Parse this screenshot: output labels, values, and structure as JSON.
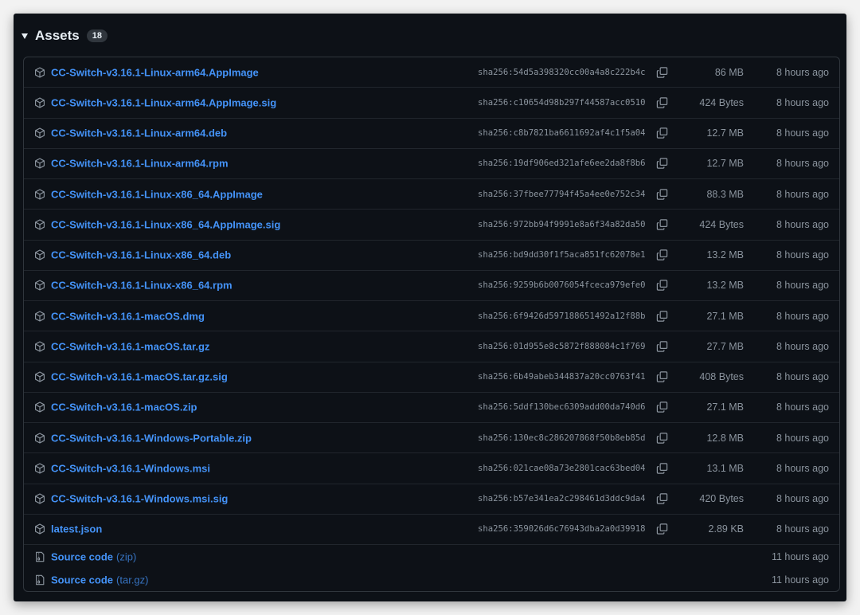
{
  "header": {
    "title": "Assets",
    "count": "18"
  },
  "assets": [
    {
      "name": "CC-Switch-v3.16.1-Linux-arm64.AppImage",
      "sha": "sha256:54d5a398320cc00a4a8c222b4c",
      "size": "86 MB",
      "time": "8 hours ago"
    },
    {
      "name": "CC-Switch-v3.16.1-Linux-arm64.AppImage.sig",
      "sha": "sha256:c10654d98b297f44587acc0510",
      "size": "424 Bytes",
      "time": "8 hours ago"
    },
    {
      "name": "CC-Switch-v3.16.1-Linux-arm64.deb",
      "sha": "sha256:c8b7821ba6611692af4c1f5a04",
      "size": "12.7 MB",
      "time": "8 hours ago"
    },
    {
      "name": "CC-Switch-v3.16.1-Linux-arm64.rpm",
      "sha": "sha256:19df906ed321afe6ee2da8f8b6",
      "size": "12.7 MB",
      "time": "8 hours ago"
    },
    {
      "name": "CC-Switch-v3.16.1-Linux-x86_64.AppImage",
      "sha": "sha256:37fbee77794f45a4ee0e752c34",
      "size": "88.3 MB",
      "time": "8 hours ago"
    },
    {
      "name": "CC-Switch-v3.16.1-Linux-x86_64.AppImage.sig",
      "sha": "sha256:972bb94f9991e8a6f34a82da50",
      "size": "424 Bytes",
      "time": "8 hours ago"
    },
    {
      "name": "CC-Switch-v3.16.1-Linux-x86_64.deb",
      "sha": "sha256:bd9dd30f1f5aca851fc62078e1",
      "size": "13.2 MB",
      "time": "8 hours ago"
    },
    {
      "name": "CC-Switch-v3.16.1-Linux-x86_64.rpm",
      "sha": "sha256:9259b6b0076054fceca979efe0",
      "size": "13.2 MB",
      "time": "8 hours ago"
    },
    {
      "name": "CC-Switch-v3.16.1-macOS.dmg",
      "sha": "sha256:6f9426d597188651492a12f88b",
      "size": "27.1 MB",
      "time": "8 hours ago"
    },
    {
      "name": "CC-Switch-v3.16.1-macOS.tar.gz",
      "sha": "sha256:01d955e8c5872f888084c1f769",
      "size": "27.7 MB",
      "time": "8 hours ago"
    },
    {
      "name": "CC-Switch-v3.16.1-macOS.tar.gz.sig",
      "sha": "sha256:6b49abeb344837a20cc0763f41",
      "size": "408 Bytes",
      "time": "8 hours ago"
    },
    {
      "name": "CC-Switch-v3.16.1-macOS.zip",
      "sha": "sha256:5ddf130bec6309add00da740d6",
      "size": "27.1 MB",
      "time": "8 hours ago"
    },
    {
      "name": "CC-Switch-v3.16.1-Windows-Portable.zip",
      "sha": "sha256:130ec8c286207868f50b8eb85d",
      "size": "12.8 MB",
      "time": "8 hours ago"
    },
    {
      "name": "CC-Switch-v3.16.1-Windows.msi",
      "sha": "sha256:021cae08a73e2801cac63bed04",
      "size": "13.1 MB",
      "time": "8 hours ago"
    },
    {
      "name": "CC-Switch-v3.16.1-Windows.msi.sig",
      "sha": "sha256:b57e341ea2c298461d3ddc9da4",
      "size": "420 Bytes",
      "time": "8 hours ago"
    },
    {
      "name": "latest.json",
      "sha": "sha256:359026d6c76943dba2a0d39918",
      "size": "2.89 KB",
      "time": "8 hours ago"
    }
  ],
  "source_code": [
    {
      "label": "Source code",
      "format": "(zip)",
      "time": "11 hours ago"
    },
    {
      "label": "Source code",
      "format": "(tar.gz)",
      "time": "11 hours ago"
    }
  ],
  "icons": {
    "asset": "package-icon",
    "copy": "copy-icon",
    "source": "file-zip-icon"
  },
  "colors": {
    "background": "#0d1117",
    "link": "#4493f8",
    "muted": "#8b949e",
    "border": "#30363d"
  }
}
